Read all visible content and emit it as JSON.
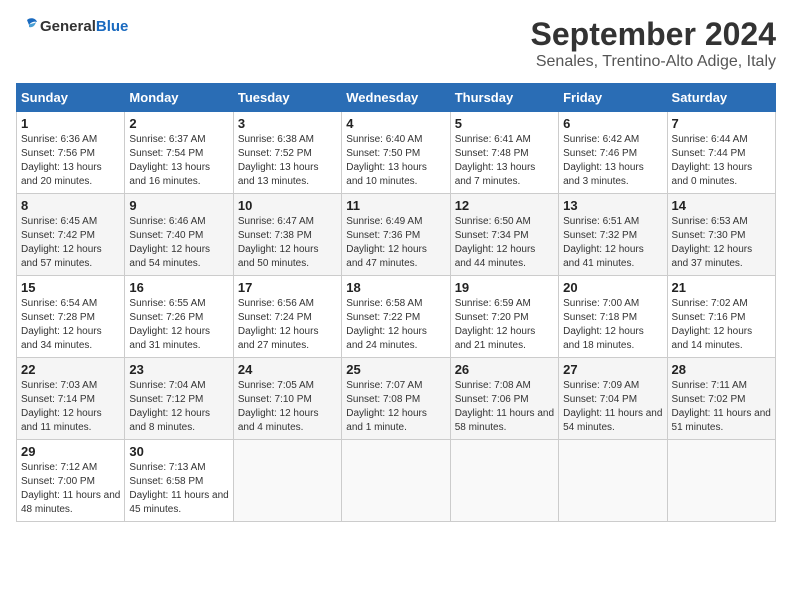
{
  "header": {
    "logo_line1": "General",
    "logo_line2": "Blue",
    "month_title": "September 2024",
    "location": "Senales, Trentino-Alto Adige, Italy"
  },
  "weekdays": [
    "Sunday",
    "Monday",
    "Tuesday",
    "Wednesday",
    "Thursday",
    "Friday",
    "Saturday"
  ],
  "weeks": [
    [
      {
        "day": "1",
        "sunrise": "6:36 AM",
        "sunset": "7:56 PM",
        "daylight": "13 hours and 20 minutes"
      },
      {
        "day": "2",
        "sunrise": "6:37 AM",
        "sunset": "7:54 PM",
        "daylight": "13 hours and 16 minutes"
      },
      {
        "day": "3",
        "sunrise": "6:38 AM",
        "sunset": "7:52 PM",
        "daylight": "13 hours and 13 minutes"
      },
      {
        "day": "4",
        "sunrise": "6:40 AM",
        "sunset": "7:50 PM",
        "daylight": "13 hours and 10 minutes"
      },
      {
        "day": "5",
        "sunrise": "6:41 AM",
        "sunset": "7:48 PM",
        "daylight": "13 hours and 7 minutes"
      },
      {
        "day": "6",
        "sunrise": "6:42 AM",
        "sunset": "7:46 PM",
        "daylight": "13 hours and 3 minutes"
      },
      {
        "day": "7",
        "sunrise": "6:44 AM",
        "sunset": "7:44 PM",
        "daylight": "13 hours and 0 minutes"
      }
    ],
    [
      {
        "day": "8",
        "sunrise": "6:45 AM",
        "sunset": "7:42 PM",
        "daylight": "12 hours and 57 minutes"
      },
      {
        "day": "9",
        "sunrise": "6:46 AM",
        "sunset": "7:40 PM",
        "daylight": "12 hours and 54 minutes"
      },
      {
        "day": "10",
        "sunrise": "6:47 AM",
        "sunset": "7:38 PM",
        "daylight": "12 hours and 50 minutes"
      },
      {
        "day": "11",
        "sunrise": "6:49 AM",
        "sunset": "7:36 PM",
        "daylight": "12 hours and 47 minutes"
      },
      {
        "day": "12",
        "sunrise": "6:50 AM",
        "sunset": "7:34 PM",
        "daylight": "12 hours and 44 minutes"
      },
      {
        "day": "13",
        "sunrise": "6:51 AM",
        "sunset": "7:32 PM",
        "daylight": "12 hours and 41 minutes"
      },
      {
        "day": "14",
        "sunrise": "6:53 AM",
        "sunset": "7:30 PM",
        "daylight": "12 hours and 37 minutes"
      }
    ],
    [
      {
        "day": "15",
        "sunrise": "6:54 AM",
        "sunset": "7:28 PM",
        "daylight": "12 hours and 34 minutes"
      },
      {
        "day": "16",
        "sunrise": "6:55 AM",
        "sunset": "7:26 PM",
        "daylight": "12 hours and 31 minutes"
      },
      {
        "day": "17",
        "sunrise": "6:56 AM",
        "sunset": "7:24 PM",
        "daylight": "12 hours and 27 minutes"
      },
      {
        "day": "18",
        "sunrise": "6:58 AM",
        "sunset": "7:22 PM",
        "daylight": "12 hours and 24 minutes"
      },
      {
        "day": "19",
        "sunrise": "6:59 AM",
        "sunset": "7:20 PM",
        "daylight": "12 hours and 21 minutes"
      },
      {
        "day": "20",
        "sunrise": "7:00 AM",
        "sunset": "7:18 PM",
        "daylight": "12 hours and 18 minutes"
      },
      {
        "day": "21",
        "sunrise": "7:02 AM",
        "sunset": "7:16 PM",
        "daylight": "12 hours and 14 minutes"
      }
    ],
    [
      {
        "day": "22",
        "sunrise": "7:03 AM",
        "sunset": "7:14 PM",
        "daylight": "12 hours and 11 minutes"
      },
      {
        "day": "23",
        "sunrise": "7:04 AM",
        "sunset": "7:12 PM",
        "daylight": "12 hours and 8 minutes"
      },
      {
        "day": "24",
        "sunrise": "7:05 AM",
        "sunset": "7:10 PM",
        "daylight": "12 hours and 4 minutes"
      },
      {
        "day": "25",
        "sunrise": "7:07 AM",
        "sunset": "7:08 PM",
        "daylight": "12 hours and 1 minute"
      },
      {
        "day": "26",
        "sunrise": "7:08 AM",
        "sunset": "7:06 PM",
        "daylight": "11 hours and 58 minutes"
      },
      {
        "day": "27",
        "sunrise": "7:09 AM",
        "sunset": "7:04 PM",
        "daylight": "11 hours and 54 minutes"
      },
      {
        "day": "28",
        "sunrise": "7:11 AM",
        "sunset": "7:02 PM",
        "daylight": "11 hours and 51 minutes"
      }
    ],
    [
      {
        "day": "29",
        "sunrise": "7:12 AM",
        "sunset": "7:00 PM",
        "daylight": "11 hours and 48 minutes"
      },
      {
        "day": "30",
        "sunrise": "7:13 AM",
        "sunset": "6:58 PM",
        "daylight": "11 hours and 45 minutes"
      },
      null,
      null,
      null,
      null,
      null
    ]
  ]
}
